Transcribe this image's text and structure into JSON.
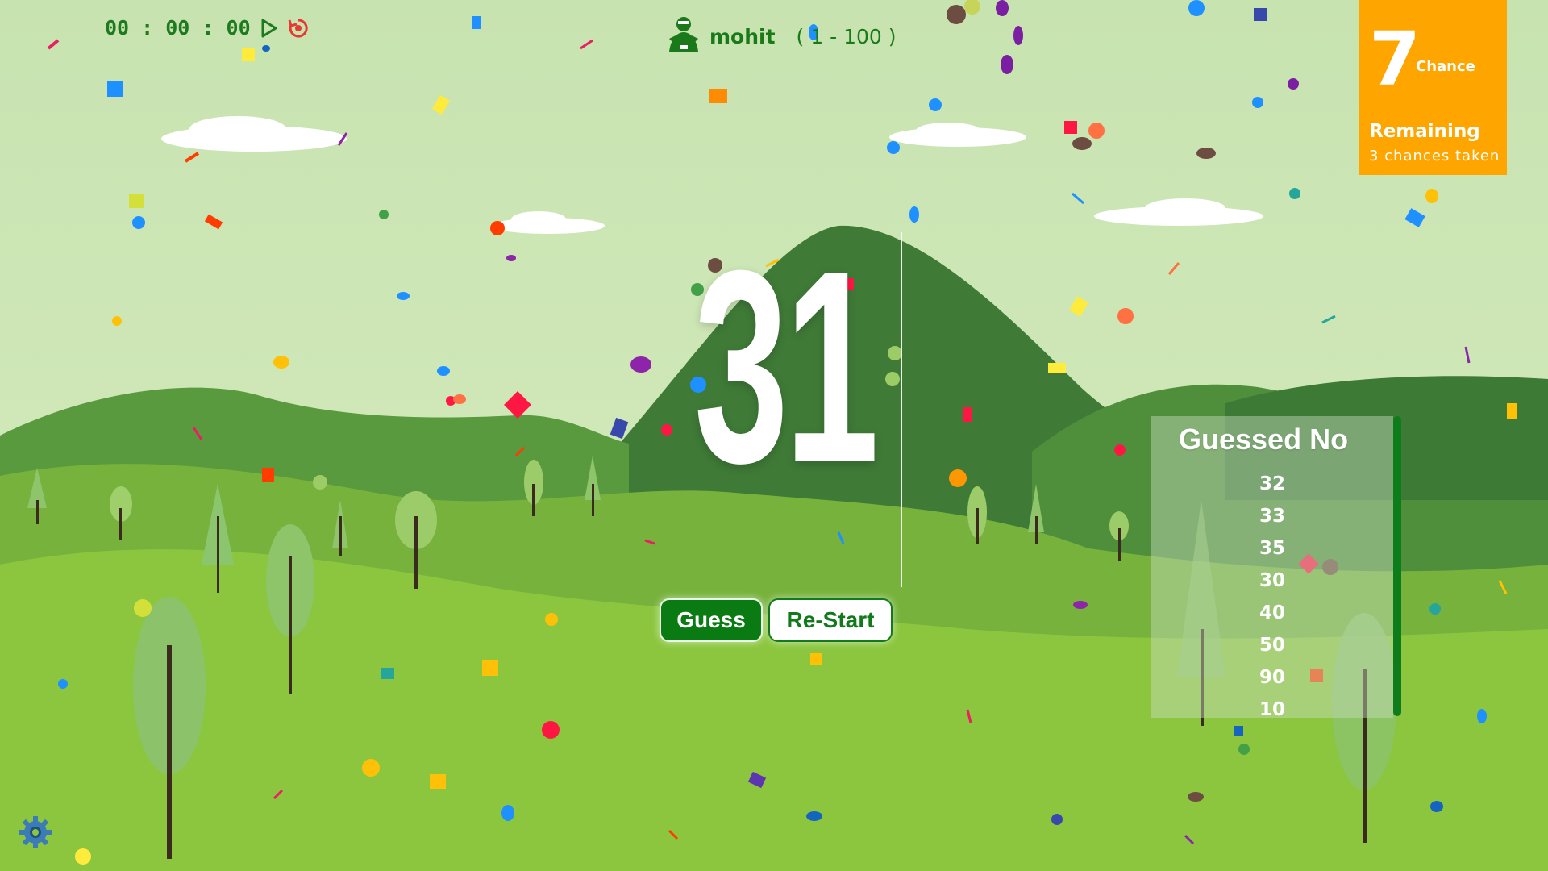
{
  "timer": {
    "display": "00 : 00 : 00",
    "play_icon": "play-icon",
    "restart_icon": "reset-icon",
    "color": "#1e7a1e"
  },
  "player": {
    "name": "mohit",
    "range": "( 1 - 100 )",
    "avatar_icon": "player-avatar-icon"
  },
  "chances": {
    "remaining_value": "7",
    "remaining_unit": "Chance",
    "remaining_label": "Remaining",
    "taken_label": "3 chances taken",
    "panel_color": "#ffa500"
  },
  "display": {
    "number": "31"
  },
  "buttons": {
    "guess": "Guess",
    "restart": "Re-Start"
  },
  "guessed": {
    "title": "Guessed No",
    "items": [
      "32",
      "33",
      "35",
      "30",
      "40",
      "50",
      "90",
      "10"
    ]
  },
  "settings": {
    "icon": "gear-icon"
  },
  "colors": {
    "sky": "#cde7b2",
    "accent_green": "#0a7a12",
    "hill_dark": "#3f7a37",
    "grass": "#8ec63f"
  }
}
